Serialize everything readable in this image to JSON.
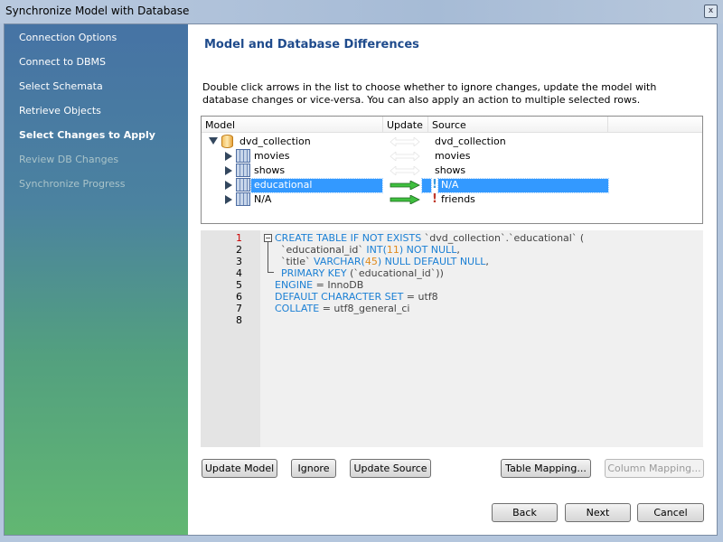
{
  "window": {
    "title": "Synchronize Model with Database",
    "close_glyph": "x"
  },
  "sidebar": {
    "items": [
      {
        "label": "Connection Options",
        "state": "done"
      },
      {
        "label": "Connect to DBMS",
        "state": "done"
      },
      {
        "label": "Select Schemata",
        "state": "done"
      },
      {
        "label": "Retrieve Objects",
        "state": "done"
      },
      {
        "label": "Select Changes to Apply",
        "state": "active"
      },
      {
        "label": "Review DB Changes",
        "state": "disabled"
      },
      {
        "label": "Synchronize Progress",
        "state": "disabled"
      }
    ]
  },
  "main": {
    "heading": "Model and Database Differences",
    "description": "Double click arrows in the list to choose whether to ignore changes, update the model with database changes or vice-versa. You can also apply an action to multiple selected rows.",
    "tree": {
      "columns": [
        "Model",
        "Update",
        "Source"
      ],
      "rows": [
        {
          "model": "dvd_collection",
          "source": "dvd_collection",
          "icon": "database-icon",
          "level": 0,
          "expanded": true,
          "arrow": "none",
          "warn": "",
          "selected": false
        },
        {
          "model": "movies",
          "source": "movies",
          "icon": "table-icon",
          "level": 1,
          "expanded": false,
          "arrow": "none",
          "warn": "",
          "selected": false
        },
        {
          "model": "shows",
          "source": "shows",
          "icon": "table-icon",
          "level": 1,
          "expanded": false,
          "arrow": "none",
          "warn": "",
          "selected": false
        },
        {
          "model": "educational",
          "source": "N/A",
          "icon": "table-icon",
          "level": 1,
          "expanded": false,
          "arrow": "right",
          "warn": "!",
          "selected": true
        },
        {
          "model": "N/A",
          "source": "friends",
          "icon": "table-icon",
          "level": 1,
          "expanded": false,
          "arrow": "right",
          "warn": "!",
          "selected": false
        }
      ]
    },
    "editor": {
      "line_numbers": [
        "1",
        "2",
        "3",
        "4",
        "5",
        "6",
        "7",
        "8"
      ],
      "lines": [
        [
          [
            "kw",
            "CREATE TABLE IF NOT EXISTS "
          ],
          [
            "id",
            "`dvd_collection`.`educational` ("
          ]
        ],
        [
          [
            "id",
            "  `educational_id` "
          ],
          [
            "kw",
            "INT("
          ],
          [
            "num",
            "11"
          ],
          [
            "kw",
            ") NOT NULL"
          ],
          [
            "id",
            ","
          ]
        ],
        [
          [
            "id",
            "  `title` "
          ],
          [
            "kw",
            "VARCHAR("
          ],
          [
            "num",
            "45"
          ],
          [
            "kw",
            ") NULL DEFAULT NULL"
          ],
          [
            "id",
            ","
          ]
        ],
        [
          [
            "kw",
            "  PRIMARY KEY "
          ],
          [
            "id",
            "(`educational_id`))"
          ]
        ],
        [
          [
            "kw",
            "ENGINE "
          ],
          [
            "id",
            "= InnoDB"
          ]
        ],
        [
          [
            "kw",
            "DEFAULT CHARACTER SET "
          ],
          [
            "id",
            "= utf8"
          ]
        ],
        [
          [
            "kw",
            "COLLATE "
          ],
          [
            "id",
            "= utf8_general_ci"
          ]
        ],
        []
      ]
    }
  },
  "buttons": {
    "update_model": "Update Model",
    "ignore": "Ignore",
    "update_source": "Update Source",
    "table_mapping": "Table Mapping...",
    "column_mapping": "Column Mapping...",
    "back": "Back",
    "next": "Next",
    "cancel": "Cancel"
  },
  "colors": {
    "heading": "#1f4b8c",
    "selection": "#3399ff",
    "keyword": "#1a7fd4",
    "number": "#e08a1b",
    "arrow": "#3fbf3f",
    "warn_selected": "#3a9be0",
    "warn": "#c0392b"
  }
}
